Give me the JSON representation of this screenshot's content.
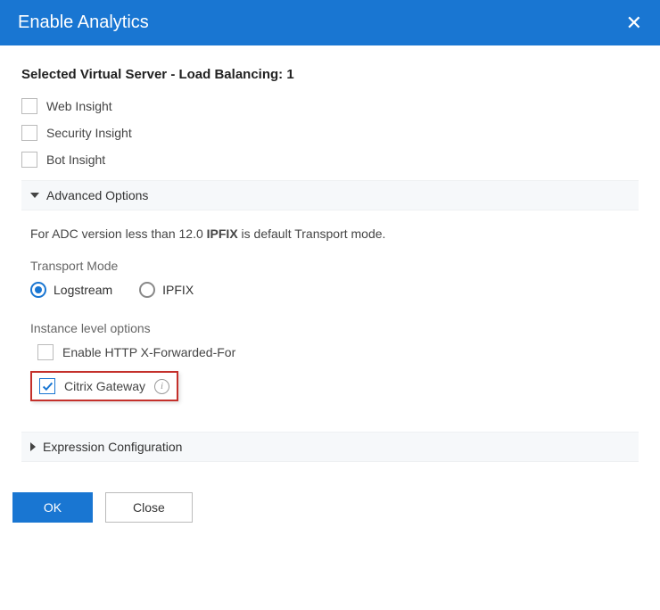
{
  "header": {
    "title": "Enable Analytics"
  },
  "subtitle": "Selected Virtual Server - Load Balancing: 1",
  "checkboxes": {
    "web_insight": "Web Insight",
    "security_insight": "Security Insight",
    "bot_insight": "Bot Insight"
  },
  "advanced": {
    "label": "Advanced Options",
    "info_prefix": "For ADC version less than 12.0 ",
    "info_bold": "IPFIX",
    "info_suffix": " is default Transport mode.",
    "transport_mode_label": "Transport Mode",
    "radios": {
      "logstream": "Logstream",
      "ipfix": "IPFIX"
    },
    "instance_label": "Instance level options",
    "xff": "Enable HTTP X-Forwarded-For",
    "citrix": "Citrix Gateway"
  },
  "expression": {
    "label": "Expression Configuration"
  },
  "footer": {
    "ok": "OK",
    "close": "Close"
  }
}
